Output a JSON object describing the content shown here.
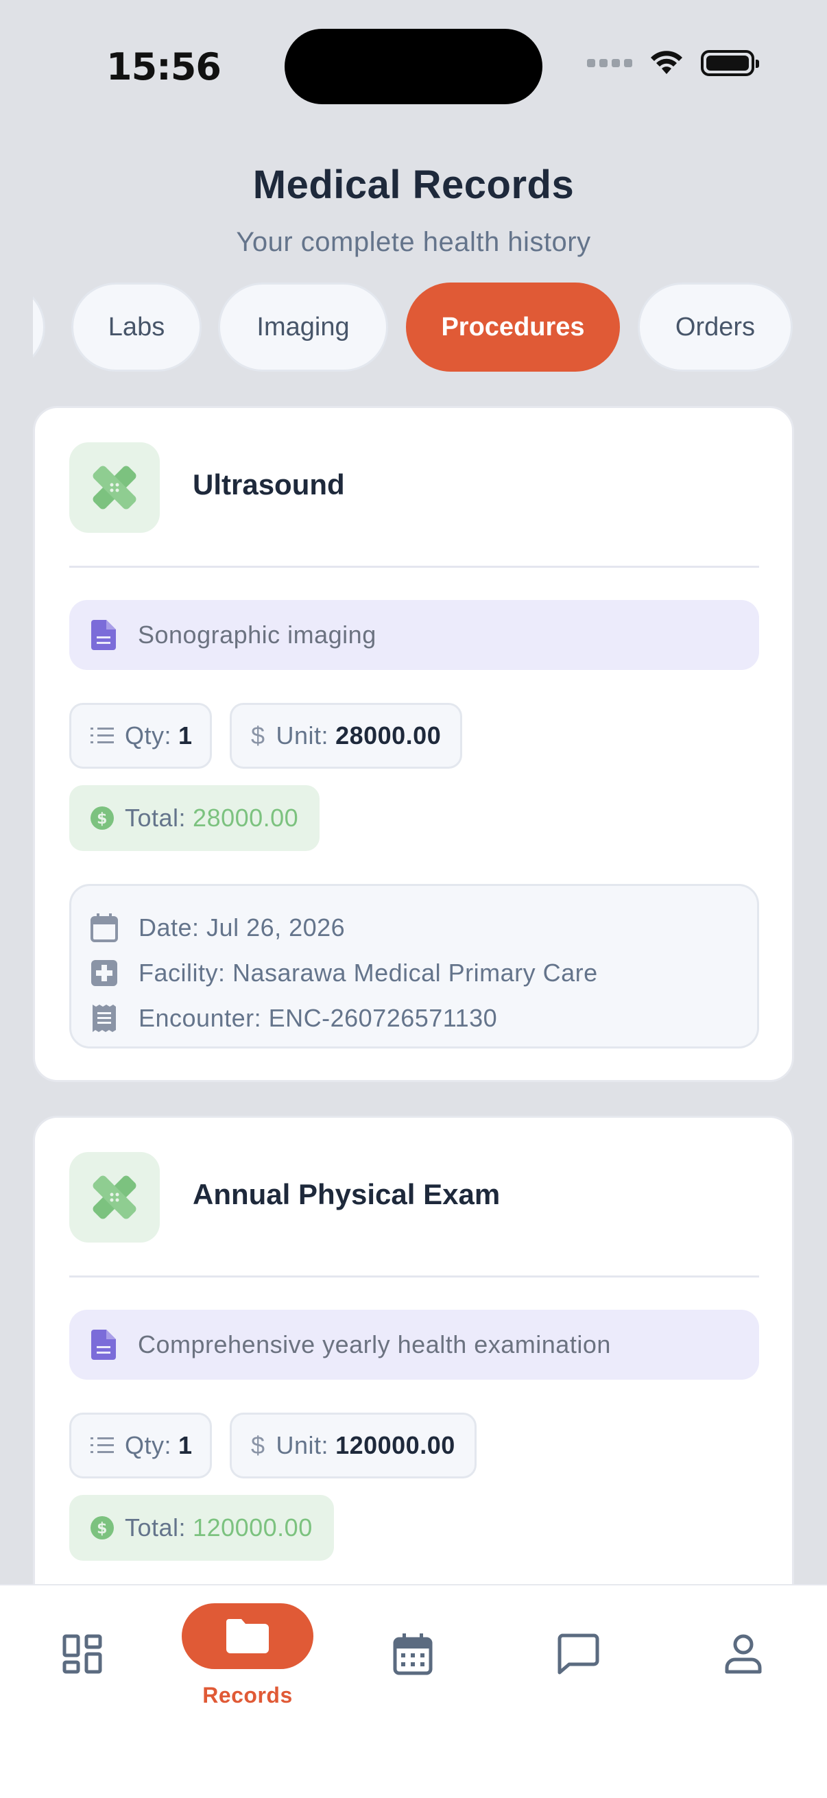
{
  "status_bar": {
    "time": "15:56"
  },
  "header": {
    "title": "Medical Records",
    "subtitle": "Your complete health history"
  },
  "tabs": [
    {
      "label": ""
    },
    {
      "label": "Labs"
    },
    {
      "label": "Imaging"
    },
    {
      "label": "Procedures",
      "active": true
    },
    {
      "label": "Orders"
    }
  ],
  "records": [
    {
      "title": "Ultrasound",
      "description": "Sonographic imaging",
      "qty_label": "Qty:",
      "qty": "1",
      "unit_label": "Unit:",
      "unit": "28000.00",
      "total_label": "Total:",
      "total": "28000.00",
      "date": "Date: Jul 26, 2026",
      "facility": "Facility: Nasarawa Medical Primary Care",
      "encounter": "Encounter: ENC-260726571130"
    },
    {
      "title": "Annual Physical Exam",
      "description": "Comprehensive yearly health examination",
      "qty_label": "Qty:",
      "qty": "1",
      "unit_label": "Unit:",
      "unit": "120000.00",
      "total_label": "Total:",
      "total": "120000.00"
    }
  ],
  "bottom_nav": {
    "items": [
      {
        "icon": "dashboard-icon"
      },
      {
        "icon": "folder-icon",
        "label": "Records",
        "active": true
      },
      {
        "icon": "calendar-icon"
      },
      {
        "icon": "chat-icon"
      },
      {
        "icon": "user-icon"
      }
    ]
  },
  "colors": {
    "accent": "#e05a36",
    "background": "#dfe1e6",
    "success": "#7cc27f",
    "procedure_icon": "#7cc27f",
    "description_bg": "#ecebfb",
    "description_icon": "#7b6cd9"
  }
}
